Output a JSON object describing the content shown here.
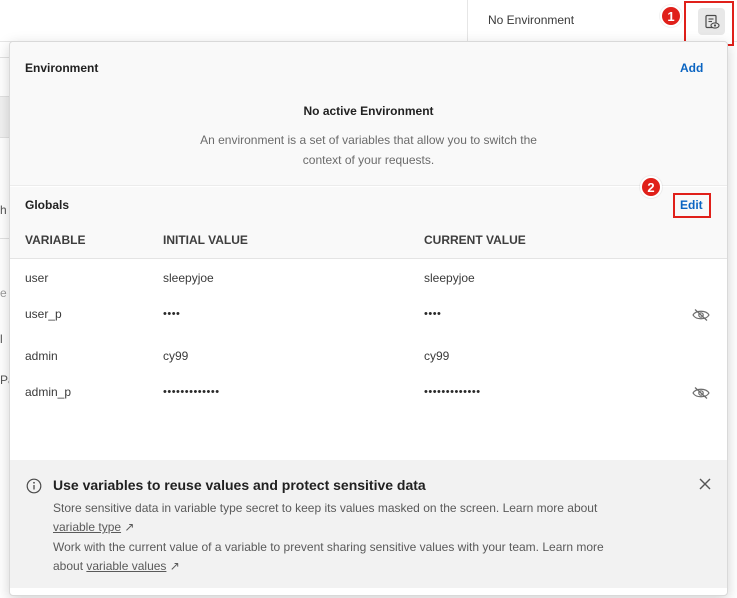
{
  "header": {
    "environment_selector": "No Environment"
  },
  "steps": {
    "one": "1",
    "two": "2"
  },
  "environment": {
    "title": "Environment",
    "add_label": "Add",
    "empty_title": "No active Environment",
    "empty_description": "An environment is a set of variables that allow you to switch the context of your requests."
  },
  "globals": {
    "title": "Globals",
    "edit_label": "Edit",
    "columns": [
      "VARIABLE",
      "INITIAL VALUE",
      "CURRENT VALUE"
    ],
    "rows": [
      {
        "variable": "user",
        "initial": "sleepyjoe",
        "current": "sleepyjoe",
        "secret": false
      },
      {
        "variable": "user_p",
        "initial": "••••",
        "current": "••••",
        "secret": true
      },
      {
        "variable": "admin",
        "initial": "cy99",
        "current": "cy99",
        "secret": false
      },
      {
        "variable": "admin_p",
        "initial": "•••••••••••••",
        "current": "•••••••••••••",
        "secret": true
      }
    ]
  },
  "tip": {
    "title": "Use variables to reuse values and protect sensitive data",
    "line1": "Store sensitive data in variable type secret to keep its values masked on the screen. Learn more about",
    "link1": "variable type",
    "line2": "Work with the current value of a variable to prevent sharing sensitive values with your team. Learn more",
    "line3_prefix": "about",
    "link2": "variable values",
    "arrow": "↗"
  },
  "background_fragments": {
    "frag1": "h",
    "frag2": "e",
    "frag3": "l",
    "frag4": "Pa"
  },
  "colors": {
    "accent_link": "#0b65c2",
    "highlight_red": "#e0201a"
  },
  "icons": {
    "environment_quick_look": "eye-document-icon",
    "info": "info-icon",
    "close": "close-icon",
    "hidden": "eye-slash-icon"
  }
}
